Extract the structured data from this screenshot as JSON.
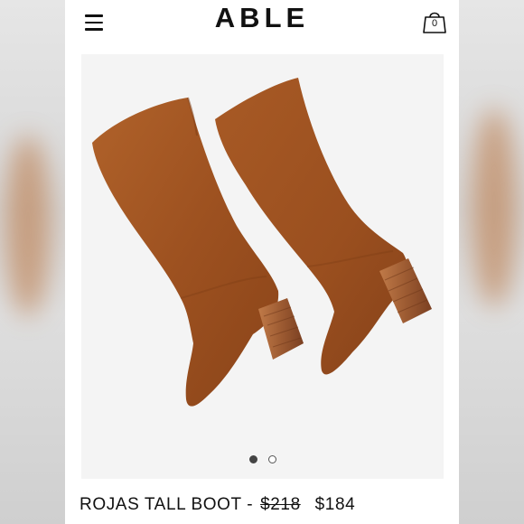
{
  "header": {
    "logo": "ABLE",
    "cart_count": "0",
    "menu_icon": "hamburger-menu-icon",
    "cart_icon": "shopping-bag-icon"
  },
  "product": {
    "name": "ROJAS TALL BOOT -",
    "original_price": "$218",
    "sale_price": "$184",
    "image_count": 2,
    "active_image": 1
  },
  "colors": {
    "suede": "#a0531f",
    "heel": "#9b5a30",
    "image_bg": "#f4f4f4"
  }
}
